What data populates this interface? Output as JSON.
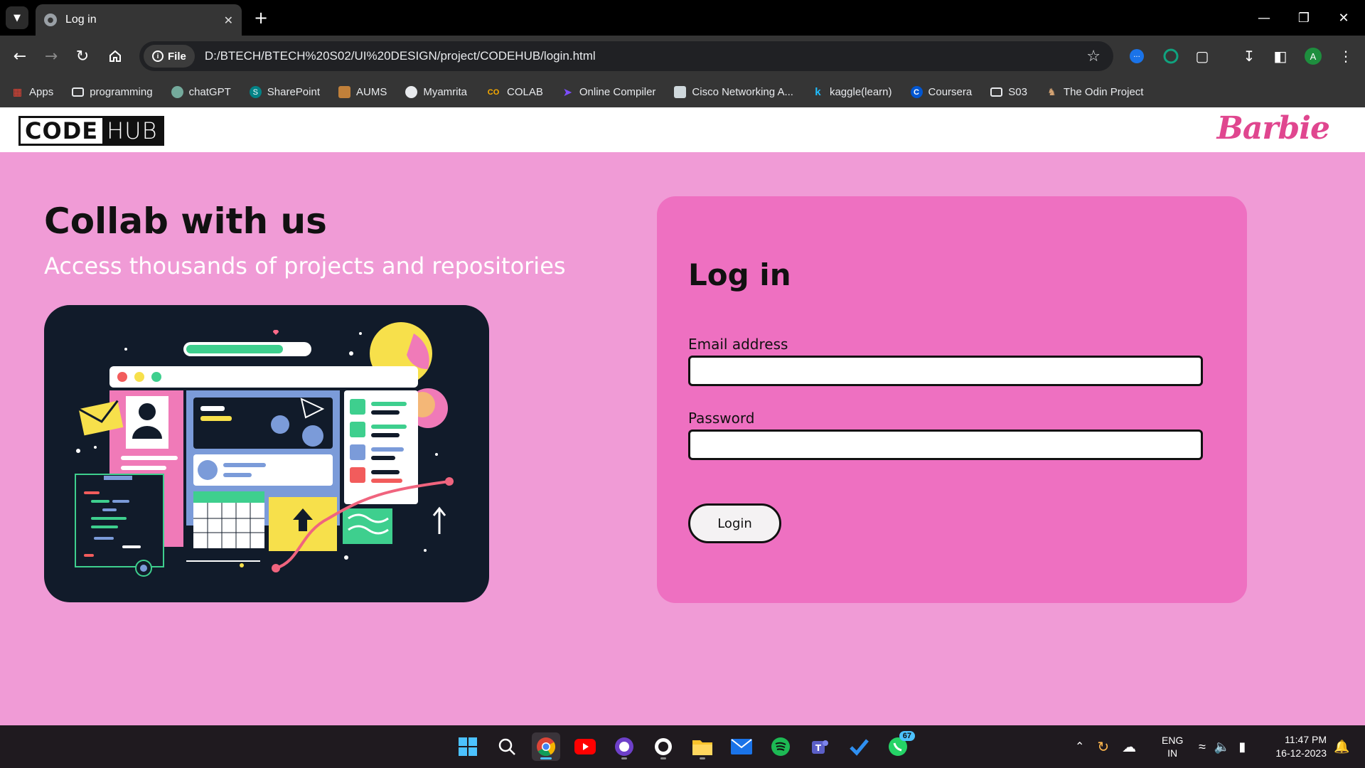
{
  "browser": {
    "tab_title": "Log in",
    "site_info_label": "File",
    "url": "D:/BTECH/BTECH%20S02/UI%20DESIGN/project/CODEHUB/login.html",
    "profile_initial": "A"
  },
  "bookmarks": [
    {
      "label": "Apps",
      "icon": "apps-grid-icon"
    },
    {
      "label": "programming",
      "icon": "folder-icon"
    },
    {
      "label": "chatGPT",
      "icon": "chatgpt-icon"
    },
    {
      "label": "SharePoint",
      "icon": "sharepoint-icon"
    },
    {
      "label": "AUMS",
      "icon": "aums-icon"
    },
    {
      "label": "Myamrita",
      "icon": "globe-icon"
    },
    {
      "label": "COLAB",
      "icon": "colab-icon"
    },
    {
      "label": "Online Compiler",
      "icon": "compiler-icon"
    },
    {
      "label": "Cisco Networking A...",
      "icon": "cisco-icon"
    },
    {
      "label": "kaggle(learn)",
      "icon": "kaggle-icon"
    },
    {
      "label": "Coursera",
      "icon": "coursera-icon"
    },
    {
      "label": "S03",
      "icon": "folder-icon"
    },
    {
      "label": "The Odin Project",
      "icon": "odin-icon"
    }
  ],
  "header": {
    "logo_code": "CODE",
    "logo_hub": "HUB",
    "brand_right": "Barbie"
  },
  "hero": {
    "title": "Collab with us",
    "subtitle": "Access thousands of projects and repositories"
  },
  "login": {
    "title": "Log in",
    "email_label": "Email address",
    "email_value": "",
    "password_label": "Password",
    "password_value": "",
    "button_label": "Login"
  },
  "taskbar": {
    "whatsapp_badge": "67",
    "lang_line1": "ENG",
    "lang_line2": "IN",
    "time": "11:47 PM",
    "date": "16-12-2023"
  },
  "colors": {
    "page_bg": "#f09bd6",
    "card_bg": "#ee70c1",
    "brand_pink": "#e0468f"
  }
}
